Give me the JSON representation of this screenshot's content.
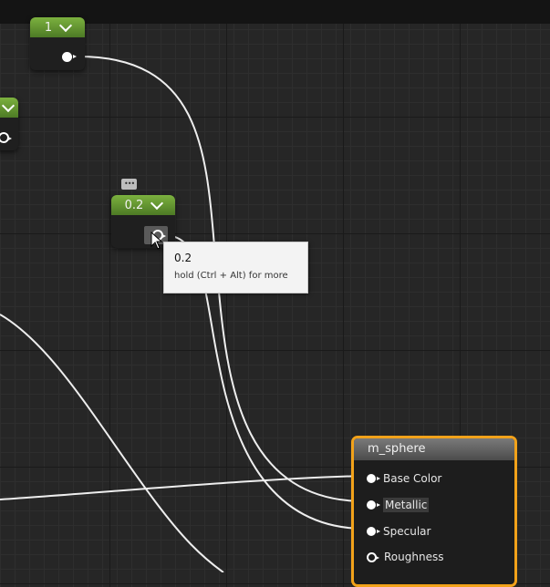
{
  "nodes": {
    "constant_a": {
      "value": "1"
    },
    "constant_c": {
      "value": "0.2"
    }
  },
  "tooltip": {
    "title": "0.2",
    "hint": "hold (Ctrl + Alt) for more"
  },
  "material_node": {
    "title": "m_sphere",
    "pins": [
      {
        "label": "Base Color"
      },
      {
        "label": "Metallic"
      },
      {
        "label": "Specular"
      },
      {
        "label": "Roughness"
      }
    ]
  },
  "colors": {
    "accent_selected": "#f2a21a",
    "constant_header": "#6a9a36",
    "wire": "#eeeeee"
  }
}
